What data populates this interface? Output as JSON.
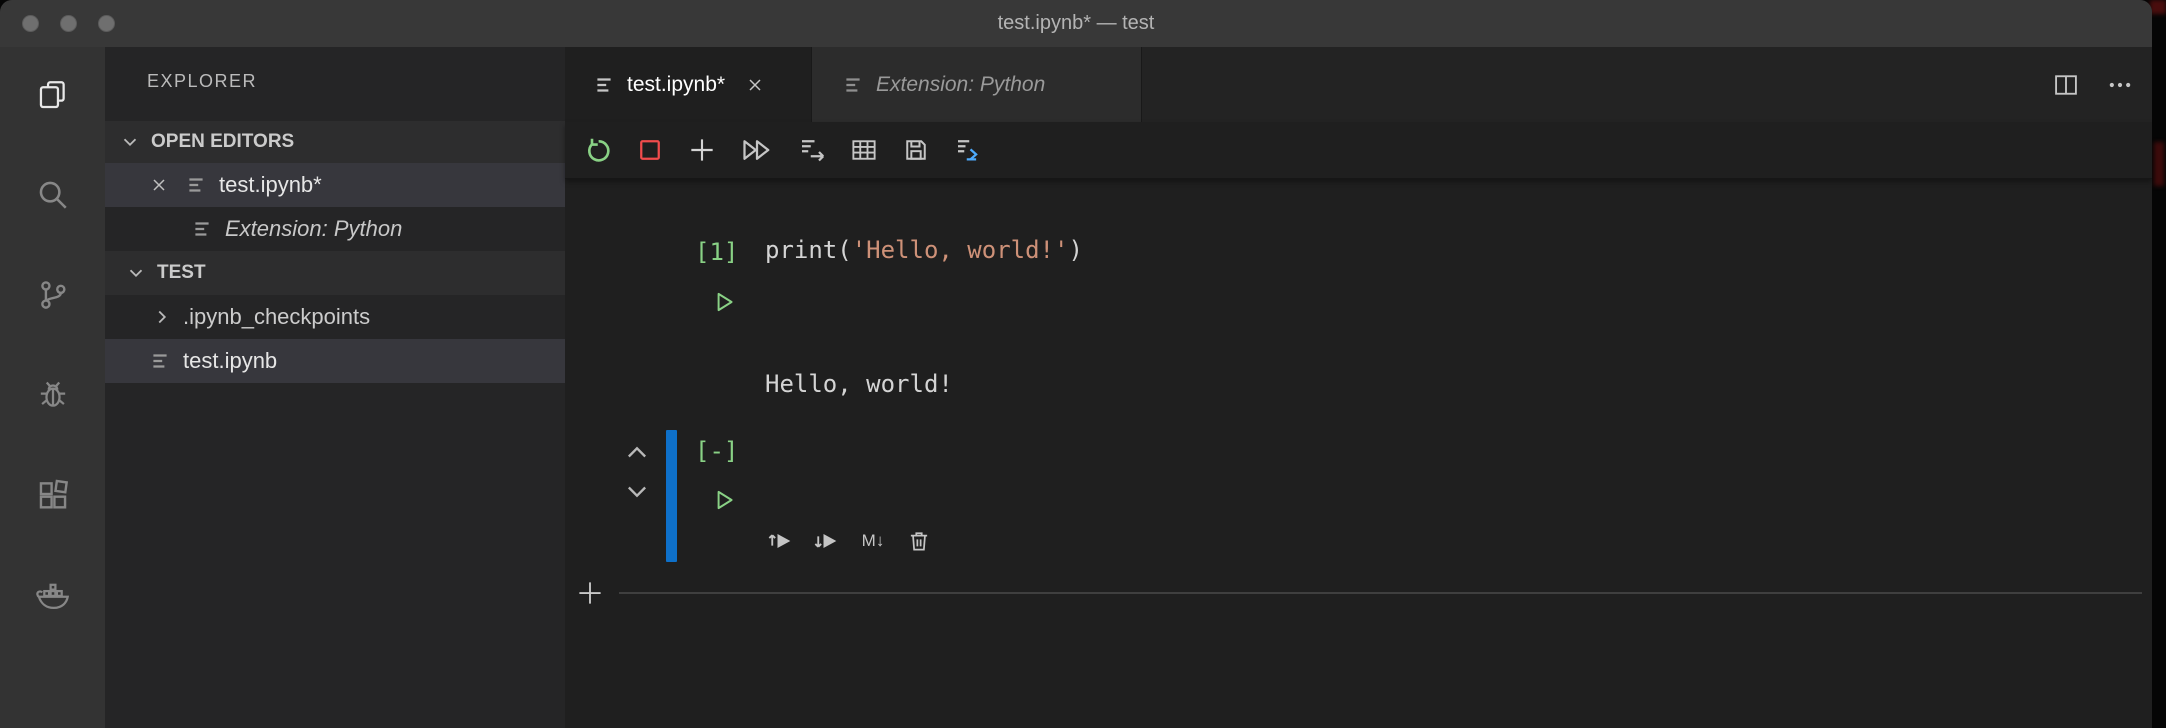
{
  "window": {
    "title": "test.ipynb* — test"
  },
  "activity_bar": {
    "icons": [
      "explorer-icon",
      "search-icon",
      "source-control-icon",
      "debug-icon",
      "extensions-icon",
      "docker-icon"
    ],
    "active": "explorer-icon"
  },
  "sidebar": {
    "title": "EXPLORER",
    "sections": [
      {
        "label": "OPEN EDITORS",
        "items": [
          {
            "label": "test.ipynb*",
            "selected": true,
            "closable": true
          },
          {
            "label": "Extension: Python",
            "preview_italic": true
          }
        ]
      },
      {
        "label": "TEST",
        "items": [
          {
            "label": ".ipynb_checkpoints",
            "type": "folder-collapsed"
          },
          {
            "label": "test.ipynb",
            "type": "notebook",
            "selected": true
          }
        ]
      }
    ]
  },
  "editor": {
    "tabs": [
      {
        "label": "test.ipynb*",
        "active": true,
        "closable": true
      },
      {
        "label": "Extension: Python",
        "preview_italic": true
      }
    ],
    "toolbar": {
      "icons": [
        "restart-kernel-icon",
        "interrupt-kernel-icon",
        "add-cell-icon",
        "run-all-cells-icon",
        "export-icon",
        "variable-explorer-icon",
        "save-icon",
        "export-python-script-icon"
      ]
    }
  },
  "notebook": {
    "cells": [
      {
        "execution_count": "[1]",
        "tokens": [
          {
            "t": "print(",
            "c": "plain"
          },
          {
            "t": "'Hello, world!'",
            "c": "string"
          },
          {
            "t": ")",
            "c": "plain"
          }
        ],
        "output": "Hello, world!"
      },
      {
        "execution_count": "[-]",
        "code": "",
        "selected": true,
        "toolbar": {
          "icons": [
            "run-above-icon",
            "run-below-icon",
            "markdown-icon",
            "delete-cell-icon"
          ],
          "markdown_label": "M↓"
        }
      }
    ]
  },
  "colors": {
    "selected_cell_bar": "#0e70c9",
    "execution_green": "#89d185",
    "interrupt_red": "#f14c4c",
    "string_color": "#ce9178",
    "editor_bg": "#1f1f1f",
    "sidebar_bg": "#252526",
    "activity_bar_bg": "#333333",
    "titlebar_bg": "#383838"
  }
}
